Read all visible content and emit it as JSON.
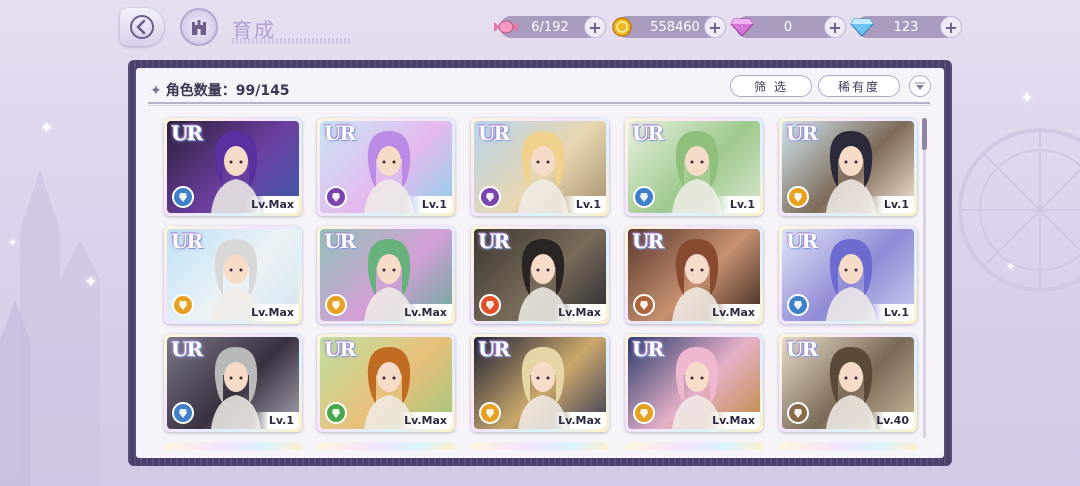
{
  "header": {
    "title": "育成"
  },
  "resources": [
    {
      "name": "candy",
      "value": "6/192",
      "color": "#e07aa6"
    },
    {
      "name": "gold-coin",
      "value": "558460",
      "color": "#f1b521"
    },
    {
      "name": "pink-diamond",
      "value": "0",
      "color": "#d576d8"
    },
    {
      "name": "blue-diamond",
      "value": "123",
      "color": "#6cc3f0"
    }
  ],
  "panel": {
    "count_label": "角色数量：99/145",
    "filter_label": "筛 选",
    "rarity_label": "稀有度"
  },
  "cards": [
    {
      "rarity": "UR",
      "level": "Lv.Max",
      "attr_color": "#3f7fc9",
      "art": [
        "#2a1f3a",
        "#6d3fa0",
        "#3b5ba8"
      ],
      "hair": "#5a2fa0"
    },
    {
      "rarity": "UR",
      "level": "Lv.1",
      "attr_color": "#7a45b0",
      "art": [
        "#c7e6f6",
        "#e6b9ee",
        "#8fd0ea"
      ],
      "hair": "#b98be6"
    },
    {
      "rarity": "UR",
      "level": "Lv.1",
      "attr_color": "#7a45b0",
      "art": [
        "#b9d6ee",
        "#e8d6b0",
        "#a68f6f"
      ],
      "hair": "#f1d28c"
    },
    {
      "rarity": "UR",
      "level": "Lv.1",
      "attr_color": "#3f7fc9",
      "art": [
        "#e8f2e0",
        "#9ec98c",
        "#d9e6d0"
      ],
      "hair": "#8fbf7a"
    },
    {
      "rarity": "UR",
      "level": "Lv.1",
      "attr_color": "#e8a020",
      "art": [
        "#cfe6f0",
        "#7e6a58",
        "#f4e7d8"
      ],
      "hair": "#2b2a3a"
    },
    {
      "rarity": "UR",
      "level": "Lv.Max",
      "attr_color": "#e8a020",
      "art": [
        "#bfe2f4",
        "#ecf3f7",
        "#d6e6ee"
      ],
      "hair": "#d8d8d8"
    },
    {
      "rarity": "UR",
      "level": "Lv.Max",
      "attr_color": "#e8a020",
      "art": [
        "#8fc2b6",
        "#d3a0d6",
        "#6aa89c"
      ],
      "hair": "#66b27a"
    },
    {
      "rarity": "UR",
      "level": "Lv.Max",
      "attr_color": "#e2502a",
      "art": [
        "#3a3630",
        "#7a6c5a",
        "#2a2a30"
      ],
      "hair": "#2a2422"
    },
    {
      "rarity": "UR",
      "level": "Lv.Max",
      "attr_color": "#b0643a",
      "art": [
        "#5a3a2e",
        "#c79070",
        "#3a2620"
      ],
      "hair": "#8a4a30"
    },
    {
      "rarity": "UR",
      "level": "Lv.1",
      "attr_color": "#3f7fc9",
      "art": [
        "#dfe6f6",
        "#8f8ad6",
        "#c9cff0"
      ],
      "hair": "#6d6ad0"
    },
    {
      "rarity": "UR",
      "level": "Lv.1",
      "attr_color": "#3f7fc9",
      "art": [
        "#7a7888",
        "#3a3040",
        "#a9a6b2"
      ],
      "hair": "#b9b9b9"
    },
    {
      "rarity": "UR",
      "level": "Lv.Max",
      "attr_color": "#4aa84a",
      "art": [
        "#bfe0a0",
        "#e8c07a",
        "#a0c880"
      ],
      "hair": "#c06a22"
    },
    {
      "rarity": "UR",
      "level": "Lv.Max",
      "attr_color": "#e8a020",
      "art": [
        "#1e2038",
        "#caa86a",
        "#3a3a5a"
      ],
      "hair": "#e6d6a6"
    },
    {
      "rarity": "UR",
      "level": "Lv.Max",
      "attr_color": "#e8a020",
      "art": [
        "#2a3a6a",
        "#e6b0c8",
        "#c08a40"
      ],
      "hair": "#f0b8d0"
    },
    {
      "rarity": "UR",
      "level": "Lv.40",
      "attr_color": "#8a6a4a",
      "art": [
        "#e6dcc6",
        "#7a6a58",
        "#c9b89a"
      ],
      "hair": "#5a4a3a"
    }
  ]
}
